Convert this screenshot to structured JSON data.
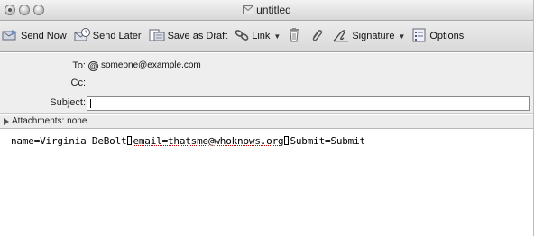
{
  "window": {
    "title": "untitled"
  },
  "toolbar": {
    "send_now": "Send Now",
    "send_later": "Send Later",
    "save_draft": "Save as Draft",
    "link": "Link",
    "signature": "Signature",
    "options": "Options",
    "icons": [
      "send-now-icon",
      "send-later-icon",
      "save-draft-icon",
      "link-icon",
      "trash-icon",
      "paperclip-icon",
      "signature-icon",
      "options-icon"
    ]
  },
  "header": {
    "to_label": "To:",
    "to_value": "someone@example.com",
    "cc_label": "Cc:",
    "subject_label": "Subject:",
    "subject_value": ""
  },
  "attachments": {
    "label": "Attachments: none"
  },
  "body": {
    "part1": "name=Virginia DeBolt",
    "part2": "email=thatsme@whoknows.org",
    "part3": "Submit=Submit"
  }
}
